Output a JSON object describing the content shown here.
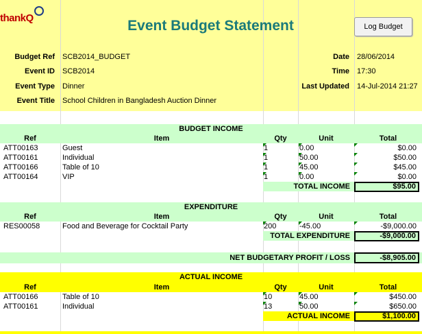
{
  "header": {
    "logo_text": "thankQ",
    "title": "Event Budget Statement",
    "log_budget_button": "Log Budget"
  },
  "meta": {
    "budget_ref_label": "Budget Ref",
    "budget_ref": "SCB2014_BUDGET",
    "event_id_label": "Event ID",
    "event_id": "SCB2014",
    "event_type_label": "Event Type",
    "event_type": "Dinner",
    "event_title_label": "Event Title",
    "event_title": "School Children in Bangladesh Auction Dinner",
    "date_label": "Date",
    "date": "28/06/2014",
    "time_label": "Time",
    "time": "17:30",
    "last_updated_label": "Last Updated",
    "last_updated": "14-Jul-2014 21:27"
  },
  "columns": {
    "ref": "Ref",
    "item": "Item",
    "qty": "Qty",
    "unit": "Unit",
    "total": "Total"
  },
  "budget_income": {
    "title": "BUDGET INCOME",
    "rows": [
      {
        "ref": "ATT00163",
        "item": "Guest",
        "qty": "1",
        "unit": "0.00",
        "total": "$0.00"
      },
      {
        "ref": "ATT00161",
        "item": "Individual",
        "qty": "1",
        "unit": "50.00",
        "total": "$50.00"
      },
      {
        "ref": "ATT00166",
        "item": "Table of 10",
        "qty": "1",
        "unit": "45.00",
        "total": "$45.00"
      },
      {
        "ref": "ATT00164",
        "item": "VIP",
        "qty": "1",
        "unit": "0.00",
        "total": "$0.00"
      }
    ],
    "total_label": "TOTAL INCOME",
    "total": "$95.00"
  },
  "expenditure": {
    "title": "EXPENDITURE",
    "rows": [
      {
        "ref": "RES00058",
        "item": "Food and Beverage for Cocktail Party",
        "qty": "200",
        "unit": "-45.00",
        "total": "-$9,000.00"
      }
    ],
    "total_label": "TOTAL EXPENDITURE",
    "total": "-$9,000.00"
  },
  "net": {
    "label": "NET BUDGETARY PROFIT / LOSS",
    "value": "-$8,905.00"
  },
  "actual_income": {
    "title": "ACTUAL INCOME",
    "rows": [
      {
        "ref": "ATT00166",
        "item": "Table of 10",
        "qty": "10",
        "unit": "45.00",
        "total": "$450.00"
      },
      {
        "ref": "ATT00161",
        "item": "Individual",
        "qty": "13",
        "unit": "50.00",
        "total": "$650.00"
      }
    ],
    "total_label": "ACTUAL INCOME",
    "total": "$1,100.00"
  },
  "colors": {
    "title": "#1a7a7a",
    "green_band": "#ccffcc",
    "yellow_band": "#ffff99",
    "bright_yellow": "#ffff00",
    "logo": "#c00000"
  }
}
